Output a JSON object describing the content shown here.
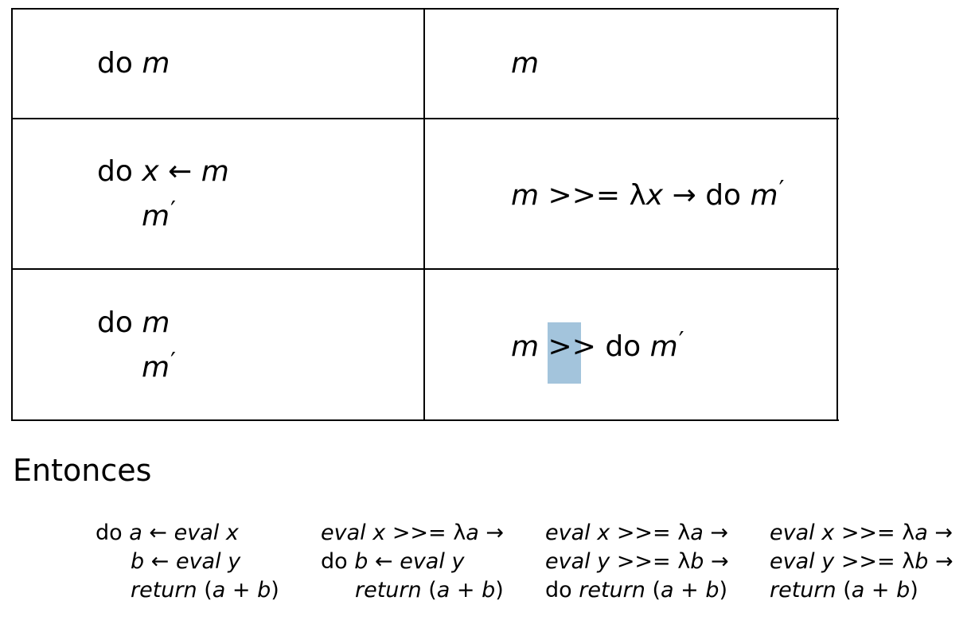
{
  "table": {
    "rows": [
      {
        "left": {
          "line1": {
            "kw": "do",
            "m": "m"
          }
        },
        "right": {
          "m": "m"
        }
      },
      {
        "left": {
          "line1": {
            "kw": "do",
            "x": "x",
            "arrow": "←",
            "m": "m"
          },
          "line2": {
            "m": "m",
            "prime": "′"
          }
        },
        "right": {
          "m": "m",
          "op": ">>=",
          "lambda": "λ",
          "x": "x",
          "arrow": "→",
          "kw": "do",
          "m2": "m",
          "prime": "′"
        }
      },
      {
        "left": {
          "line1": {
            "kw": "do",
            "m": "m"
          },
          "line2": {
            "m": "m",
            "prime": "′"
          }
        },
        "right": {
          "m": "m",
          "op": ">>",
          "kw": "do",
          "m2": "m",
          "prime": "′"
        }
      }
    ]
  },
  "heading": "Entonces",
  "steps": [
    {
      "line1": {
        "kw": "do",
        "a": "a",
        "arrow": "←",
        "eval": "eval",
        "x": "x"
      },
      "line2": {
        "b": "b",
        "arrow": "←",
        "eval": "eval",
        "y": "y"
      },
      "line3": {
        "ret": "return",
        "expr_open": "(",
        "a": "a",
        "plus": " + ",
        "b": "b",
        "expr_close": ")"
      }
    },
    {
      "line1": {
        "eval": "eval",
        "x": "x",
        "op": ">>=",
        "lambda": "λ",
        "a": "a",
        "arrow": "→"
      },
      "line2": {
        "kw": "do",
        "b": "b",
        "arrow": "←",
        "eval": "eval",
        "y": "y"
      },
      "line3": {
        "ret": "return",
        "expr_open": "(",
        "a": "a",
        "plus": " + ",
        "b": "b",
        "expr_close": ")"
      }
    },
    {
      "line1": {
        "eval": "eval",
        "x": "x",
        "op": ">>=",
        "lambda": "λ",
        "a": "a",
        "arrow": "→"
      },
      "line2": {
        "eval": "eval",
        "y": "y",
        "op": ">>=",
        "lambda": "λ",
        "b": "b",
        "arrow": "→"
      },
      "line3": {
        "kw": "do",
        "ret": "return",
        "expr_open": "(",
        "a": "a",
        "plus": " + ",
        "b": "b",
        "expr_close": ")"
      }
    },
    {
      "line1": {
        "eval": "eval",
        "x": "x",
        "op": ">>=",
        "lambda": "λ",
        "a": "a",
        "arrow": "→"
      },
      "line2": {
        "eval": "eval",
        "y": "y",
        "op": ">>=",
        "lambda": "λ",
        "b": "b",
        "arrow": "→"
      },
      "line3": {
        "ret": "return",
        "expr_open": "(",
        "a": "a",
        "plus": " + ",
        "b": "b",
        "expr_close": ")"
      }
    }
  ],
  "colors": {
    "highlight": "#a3c4dc",
    "border": "#000000"
  }
}
